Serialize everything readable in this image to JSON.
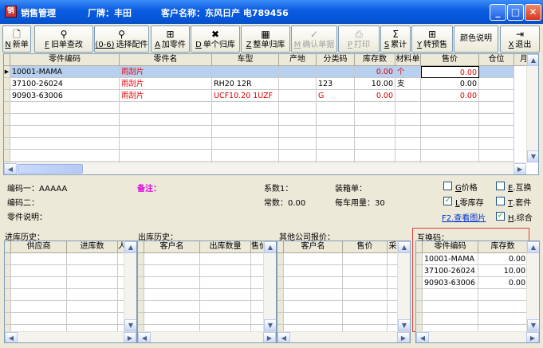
{
  "title": {
    "app": "销售管理",
    "brand": "厂牌：丰田",
    "customer": "客户名称：东风日产 电789456"
  },
  "toolbar": [
    {
      "key": "N",
      "label": "新单",
      "icon": "new-doc-icon",
      "glyph": "🗋"
    },
    {
      "key": "F",
      "label": "旧单查改",
      "icon": "binoculars-icon",
      "glyph": "⚲"
    },
    {
      "key": "(0-6)",
      "label": "选择配件",
      "icon": "binoculars-icon",
      "glyph": "⚲"
    },
    {
      "key": "A",
      "label": "加零件",
      "icon": "add-part-icon",
      "glyph": "⊞"
    },
    {
      "key": "D",
      "label": "单个归库",
      "icon": "delete-x-icon",
      "glyph": "✖"
    },
    {
      "key": "Z",
      "label": "整单归库",
      "icon": "delete-all-icon",
      "glyph": "▦"
    },
    {
      "key": "M",
      "label": "确认单据",
      "icon": "check-icon",
      "glyph": "✓"
    },
    {
      "key": "P",
      "label": "打印",
      "icon": "printer-icon",
      "glyph": "⎙"
    },
    {
      "key": "S",
      "label": "累计",
      "icon": "sigma-icon",
      "glyph": "Σ"
    },
    {
      "key": "Y",
      "label": "转预售",
      "icon": "transfer-icon",
      "glyph": "⊞"
    },
    {
      "key": "",
      "label": "颜色说明",
      "icon": "",
      "glyph": ""
    },
    {
      "key": "X",
      "label": "退出",
      "icon": "exit-door-icon",
      "glyph": "⇥"
    }
  ],
  "main_grid": {
    "headers": [
      "零件编码",
      "零件名",
      "车型",
      "产地",
      "分类码",
      "库存数",
      "材料单",
      "售价",
      "仓位",
      "月"
    ],
    "rows": [
      {
        "code": "10001-MAMA",
        "name": "雨刮片",
        "model": "",
        "origin": "",
        "cat": "",
        "stock": "0.00",
        "unit": "个",
        "price": "0.00",
        "loc": ""
      },
      {
        "code": "37100-26024",
        "name": "雨刮片",
        "model": "RH20    12R",
        "origin": "",
        "cat": "123",
        "stock": "10.00",
        "unit": "支",
        "price": "0.00",
        "loc": ""
      },
      {
        "code": "90903-63006",
        "name": "雨刮片",
        "model": "UCF10.20 1UZF",
        "origin": "",
        "cat": "G",
        "stock": "0.00",
        "unit": "",
        "price": "0.00",
        "loc": ""
      }
    ]
  },
  "info": {
    "code1": "编码一：AAAAA",
    "remark": "备注：",
    "coef": "系数1：",
    "packing": "装箱单：",
    "code2": "编码二：",
    "common": "常数：0.00",
    "yearly": "每车用量：30",
    "desc": "零件说明："
  },
  "options": [
    {
      "key": "G",
      "label": "价格",
      "checked": false
    },
    {
      "key": "E",
      "label": "互换",
      "checked": false
    },
    {
      "key": "L",
      "label": "零库存",
      "checked": true
    },
    {
      "key": "T",
      "label": "套件",
      "checked": false
    },
    {
      "key": "H",
      "label": "综合",
      "checked": true
    }
  ],
  "view_image_link": "F2.查看图片",
  "panels": {
    "inbound": {
      "title": "进库历史：",
      "headers": [
        "供应商",
        "进库数",
        "人"
      ]
    },
    "outbound": {
      "title": "出库历史：",
      "headers": [
        "客户名",
        "出库数量",
        "售价"
      ]
    },
    "quotes": {
      "title": "其他公司报价：",
      "headers": [
        "客户名",
        "售价",
        "采"
      ]
    },
    "interchange": {
      "title": "互换码：",
      "headers": [
        "零件编码",
        "库存数"
      ],
      "rows": [
        {
          "code": "10001-MAMA",
          "stock": "0.00"
        },
        {
          "code": "37100-26024",
          "stock": "10.00"
        },
        {
          "code": "90903-63006",
          "stock": "0.00"
        }
      ]
    }
  }
}
